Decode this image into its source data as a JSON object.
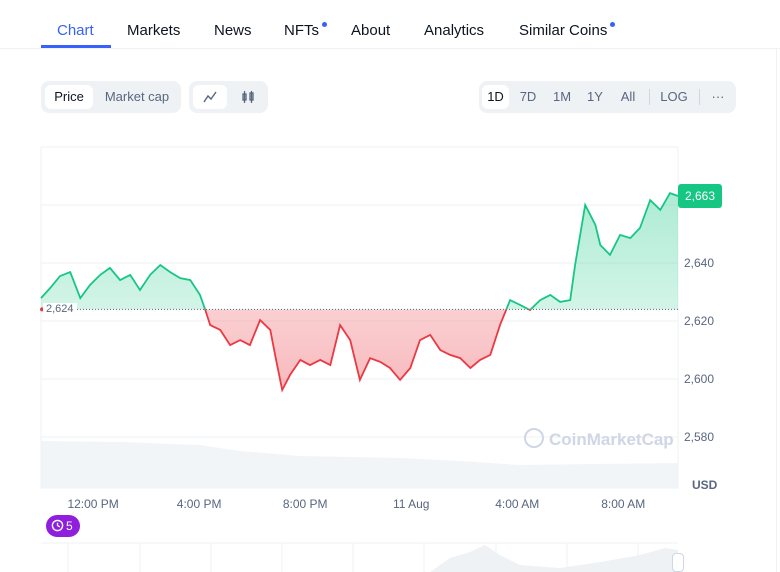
{
  "tabs": [
    {
      "label": "Chart",
      "active": true,
      "dot": false
    },
    {
      "label": "Markets",
      "dot": false
    },
    {
      "label": "News",
      "dot": false
    },
    {
      "label": "NFTs",
      "dot": true
    },
    {
      "label": "About",
      "dot": false
    },
    {
      "label": "Analytics",
      "dot": false
    },
    {
      "label": "Similar Coins",
      "dot": true
    }
  ],
  "toolbar": {
    "metric": [
      "Price",
      "Market cap"
    ],
    "metric_selected": "Price",
    "chart_types": [
      "line-chart-icon",
      "candlestick-icon"
    ],
    "chart_type_selected": "line-chart-icon",
    "ranges": [
      "1D",
      "7D",
      "1M",
      "1Y",
      "All"
    ],
    "range_selected": "1D",
    "log_label": "LOG",
    "more_label": "···"
  },
  "colors": {
    "accent": "#3861fb",
    "up": "#16c784",
    "down": "#ea3943",
    "events": "#8f1fdd"
  },
  "current_price_label": "2,663",
  "baseline_label": "2,624",
  "currency_label": "USD",
  "watermark": "CoinMarketCap",
  "events_count": "5",
  "chart_data": {
    "type": "line",
    "baseline": 2624,
    "ylim": [
      2572,
      2680
    ],
    "yticks": [
      "2,580",
      "2,600",
      "2,620",
      "2,640"
    ],
    "ytick_values": [
      2580,
      2600,
      2620,
      2640
    ],
    "xticks": [
      "12:00 PM",
      "4:00 PM",
      "8:00 PM",
      "11 Aug",
      "4:00 AM",
      "8:00 AM"
    ],
    "xtick_times": [
      "10 Aug 12:00",
      "10 Aug 16:00",
      "10 Aug 20:00",
      "11 Aug 00:00",
      "11 Aug 04:00",
      "11 Aug 08:00"
    ],
    "xlim": [
      "10 Aug 10:02",
      "11 Aug 10:04"
    ],
    "grid": true,
    "points": [
      [
        "10 Aug 10:02",
        2627.9
      ],
      [
        "10 Aug 10:23",
        2631.4
      ],
      [
        "10 Aug 10:45",
        2635.5
      ],
      [
        "10 Aug 11:08",
        2636.9
      ],
      [
        "10 Aug 11:31",
        2627.9
      ],
      [
        "10 Aug 11:53",
        2632.4
      ],
      [
        "10 Aug 12:16",
        2635.9
      ],
      [
        "10 Aug 12:38",
        2638.3
      ],
      [
        "10 Aug 13:01",
        2634.1
      ],
      [
        "10 Aug 13:24",
        2635.9
      ],
      [
        "10 Aug 13:46",
        2630.7
      ],
      [
        "10 Aug 14:09",
        2635.9
      ],
      [
        "10 Aug 14:32",
        2639.3
      ],
      [
        "10 Aug 14:54",
        2636.9
      ],
      [
        "10 Aug 15:17",
        2634.8
      ],
      [
        "10 Aug 15:40",
        2634.1
      ],
      [
        "10 Aug 16:02",
        2629.0
      ],
      [
        "10 Aug 16:14",
        2623.8
      ],
      [
        "10 Aug 16:25",
        2618.6
      ],
      [
        "10 Aug 16:48",
        2616.9
      ],
      [
        "10 Aug 17:10",
        2611.7
      ],
      [
        "10 Aug 17:33",
        2613.4
      ],
      [
        "10 Aug 17:55",
        2611.7
      ],
      [
        "10 Aug 18:18",
        2620.3
      ],
      [
        "10 Aug 18:41",
        2616.9
      ],
      [
        "10 Aug 18:52",
        2608.3
      ],
      [
        "10 Aug 19:08",
        2596.2
      ],
      [
        "10 Aug 19:26",
        2601.4
      ],
      [
        "10 Aug 19:49",
        2606.6
      ],
      [
        "10 Aug 20:11",
        2604.8
      ],
      [
        "10 Aug 20:34",
        2606.6
      ],
      [
        "10 Aug 20:57",
        2604.8
      ],
      [
        "10 Aug 21:19",
        2618.6
      ],
      [
        "10 Aug 21:42",
        2613.4
      ],
      [
        "10 Aug 22:04",
        2599.7
      ],
      [
        "10 Aug 22:27",
        2607.2
      ],
      [
        "10 Aug 22:50",
        2605.9
      ],
      [
        "10 Aug 23:12",
        2603.8
      ],
      [
        "10 Aug 23:35",
        2599.7
      ],
      [
        "10 Aug 23:58",
        2603.8
      ],
      [
        "11 Aug 00:20",
        2613.4
      ],
      [
        "11 Aug 00:43",
        2615.2
      ],
      [
        "11 Aug 01:06",
        2610.0
      ],
      [
        "11 Aug 01:28",
        2608.3
      ],
      [
        "11 Aug 01:51",
        2607.2
      ],
      [
        "11 Aug 02:14",
        2603.8
      ],
      [
        "11 Aug 02:36",
        2606.6
      ],
      [
        "11 Aug 02:59",
        2608.3
      ],
      [
        "11 Aug 03:21",
        2618.6
      ],
      [
        "11 Aug 03:44",
        2627.2
      ],
      [
        "11 Aug 04:07",
        2625.5
      ],
      [
        "11 Aug 04:29",
        2623.8
      ],
      [
        "11 Aug 04:52",
        2627.2
      ],
      [
        "11 Aug 05:15",
        2629.0
      ],
      [
        "11 Aug 05:37",
        2626.6
      ],
      [
        "11 Aug 06:00",
        2627.2
      ],
      [
        "11 Aug 06:11",
        2639.3
      ],
      [
        "11 Aug 06:34",
        2660.0
      ],
      [
        "11 Aug 06:57",
        2653.1
      ],
      [
        "11 Aug 07:08",
        2646.2
      ],
      [
        "11 Aug 07:30",
        2642.8
      ],
      [
        "11 Aug 07:53",
        2649.7
      ],
      [
        "11 Aug 08:16",
        2648.6
      ],
      [
        "11 Aug 08:38",
        2652.1
      ],
      [
        "11 Aug 09:01",
        2661.7
      ],
      [
        "11 Aug 09:24",
        2658.3
      ],
      [
        "11 Aug 09:46",
        2664.1
      ],
      [
        "11 Aug 10:04",
        2663.1
      ]
    ]
  }
}
